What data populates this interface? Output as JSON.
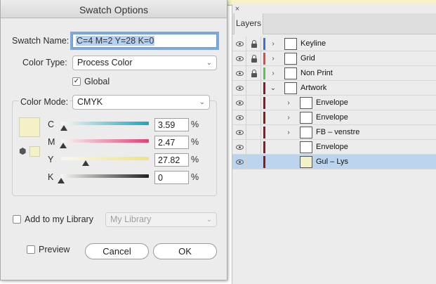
{
  "dialog": {
    "title": "Swatch Options",
    "swatch_name_label": "Swatch Name:",
    "swatch_name_value": "C=4 M=2 Y=28 K=0",
    "color_type_label": "Color Type:",
    "color_type_value": "Process Color",
    "global_label": "Global",
    "global_checked": true,
    "color_mode_label": "Color Mode:",
    "color_mode_value": "CMYK",
    "channels": [
      {
        "label": "C",
        "value": "3.59",
        "unit": "%",
        "fraction": 0.0359,
        "track_color": "#17a6c3"
      },
      {
        "label": "M",
        "value": "2.47",
        "unit": "%",
        "fraction": 0.0247,
        "track_color": "#e0427a"
      },
      {
        "label": "Y",
        "value": "27.82",
        "unit": "%",
        "fraction": 0.2782,
        "track_color": "#efe37a"
      },
      {
        "label": "K",
        "value": "0",
        "unit": "%",
        "fraction": 0.0,
        "track_color": "#222222"
      }
    ],
    "swatch_color": "#f5f1c6",
    "add_library_label": "Add to my Library",
    "library_value": "My Library",
    "preview_label": "Preview",
    "cancel_label": "Cancel",
    "ok_label": "OK"
  },
  "layers_panel": {
    "close_glyph": "×",
    "tab_label": "Layers",
    "rows": [
      {
        "name": "Keyline",
        "visible": true,
        "locked": true,
        "color": "#3e6fd6",
        "expandable": true,
        "indent": 0,
        "selected": false
      },
      {
        "name": "Grid",
        "visible": true,
        "locked": true,
        "color": "#e04a44",
        "expandable": true,
        "indent": 0,
        "selected": false
      },
      {
        "name": "Non Print",
        "visible": true,
        "locked": true,
        "color": "#57c35a",
        "expandable": true,
        "indent": 0,
        "selected": false
      },
      {
        "name": "Artwork",
        "visible": true,
        "locked": false,
        "color": "#8b1a1a",
        "expandable": true,
        "expanded": true,
        "indent": 0,
        "selected": false
      },
      {
        "name": "Envelope",
        "visible": true,
        "locked": false,
        "color": "#8b1a1a",
        "expandable": true,
        "indent": 1,
        "selected": false
      },
      {
        "name": "Envelope",
        "visible": true,
        "locked": false,
        "color": "#8b1a1a",
        "expandable": true,
        "indent": 1,
        "selected": false
      },
      {
        "name": "FB – venstre",
        "visible": true,
        "locked": false,
        "color": "#8b1a1a",
        "expandable": true,
        "indent": 1,
        "selected": false
      },
      {
        "name": "Envelope",
        "visible": true,
        "locked": false,
        "color": "#8b1a1a",
        "expandable": false,
        "indent": 1,
        "selected": false
      },
      {
        "name": "Gul – Lys",
        "visible": true,
        "locked": false,
        "color": "#8b1a1a",
        "expandable": false,
        "indent": 1,
        "selected": true
      }
    ]
  }
}
